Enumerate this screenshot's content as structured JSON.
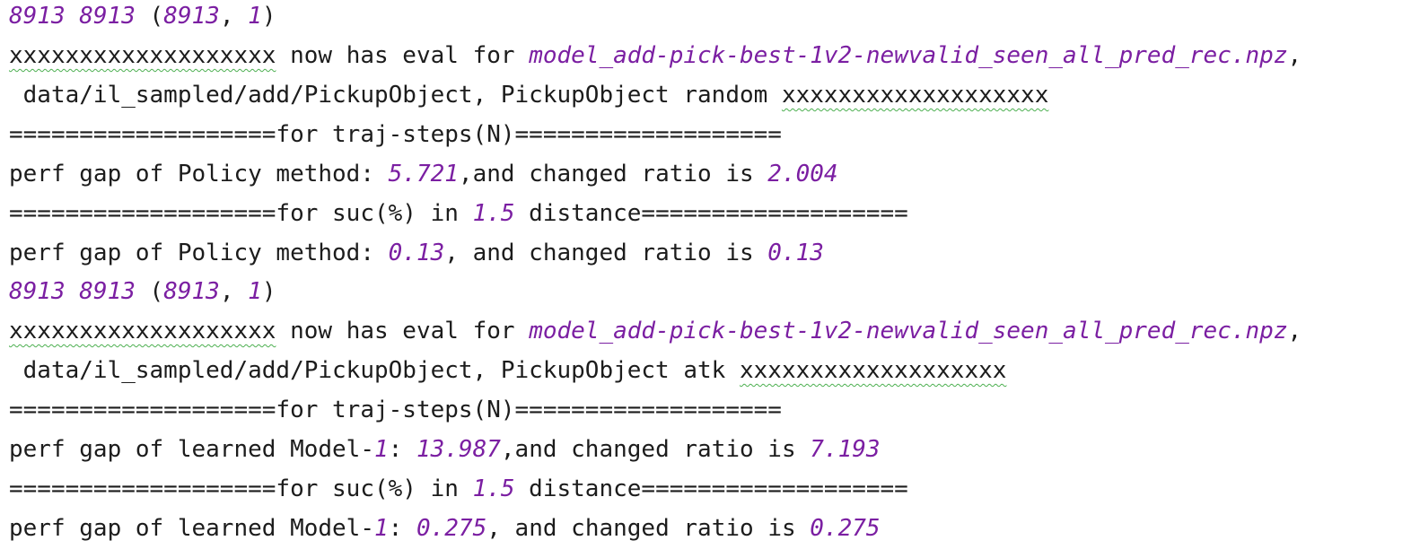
{
  "accent_colors": {
    "number": "#7b1fa2",
    "spellcheck_underline": "#4caf50",
    "text": "#1c1c1c",
    "background": "#ffffff"
  },
  "blocks": [
    {
      "shape_a": "8913",
      "shape_b": "8913",
      "shape_c": "8913",
      "shape_d": "1",
      "masked": "xxxxxxxxxxxxxxxxxxx",
      "eval_text": " now has eval for ",
      "file": "model_add-pick-best-1v2-newvalid_seen_all_pred_rec.npz",
      "comma": ",",
      "data_path": " data/il_sampled/add/PickupObject, PickupObject random ",
      "masked2": "xxxxxxxxxxxxxxxxxxx",
      "sep1_left": "===================for traj-steps(N)===================",
      "perf1_prefix": "perf gap of Policy method: ",
      "perf1_model_num": "",
      "perf1_value": "5.721",
      "perf1_mid": ",and changed ratio is ",
      "perf1_ratio": "2.004",
      "sep2_left": "===================for suc(%) in ",
      "sep2_num": "1.5",
      "sep2_right": " distance===================",
      "perf2_prefix": "perf gap of Policy method: ",
      "perf2_value": "0.13",
      "perf2_mid": ", and changed ratio is ",
      "perf2_ratio": "0.13"
    },
    {
      "shape_a": "8913",
      "shape_b": "8913",
      "shape_c": "8913",
      "shape_d": "1",
      "masked": "xxxxxxxxxxxxxxxxxxx",
      "eval_text": " now has eval for ",
      "file": "model_add-pick-best-1v2-newvalid_seen_all_pred_rec.npz",
      "comma": ",",
      "data_path": " data/il_sampled/add/PickupObject, PickupObject atk ",
      "masked2": "xxxxxxxxxxxxxxxxxxx",
      "sep1_left": "===================for traj-steps(N)===================",
      "perf1_prefix": "perf gap of learned Model-",
      "perf1_model_num": "1",
      "perf1_colon": ": ",
      "perf1_value": "13.987",
      "perf1_mid": ",and changed ratio is ",
      "perf1_ratio": "7.193",
      "sep2_left": "===================for suc(%) in ",
      "sep2_num": "1.5",
      "sep2_right": " distance===================",
      "perf2_prefix": "perf gap of learned Model-",
      "perf2_model_num": "1",
      "perf2_colon": ": ",
      "perf2_value": "0.275",
      "perf2_mid": ", and changed ratio is ",
      "perf2_ratio": "0.275"
    }
  ]
}
